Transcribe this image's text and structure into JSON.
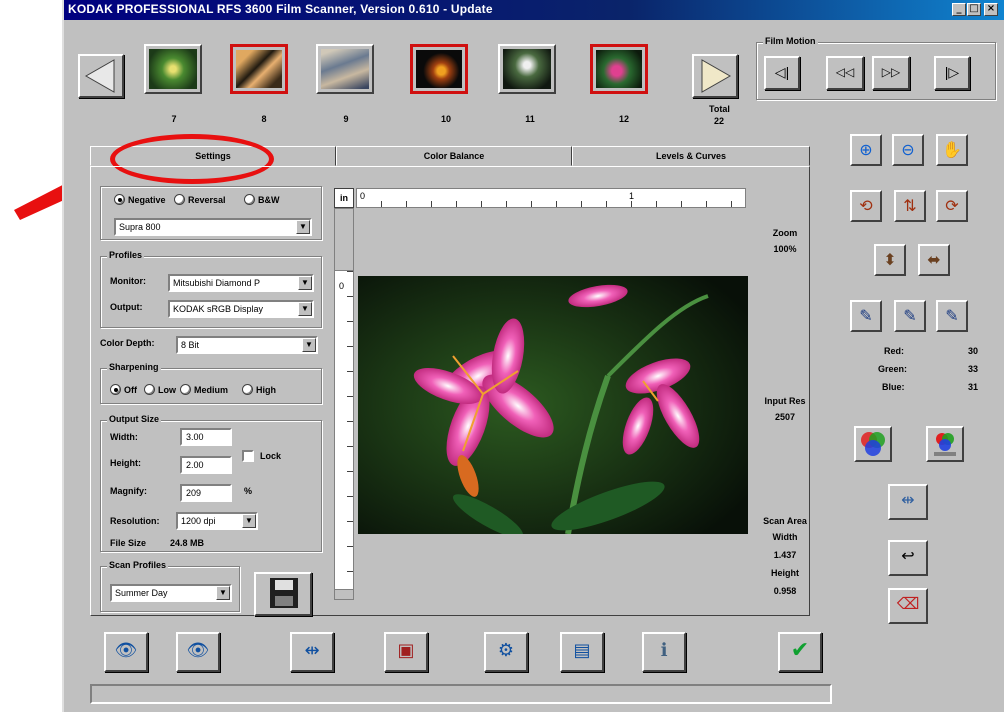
{
  "window": {
    "title": "KODAK PROFESSIONAL RFS 3600 Film Scanner, Version 0.610 - Update"
  },
  "filmstrip": {
    "thumbnails": [
      {
        "number": "7",
        "selected": false
      },
      {
        "number": "8",
        "selected": true
      },
      {
        "number": "9",
        "selected": false
      },
      {
        "number": "10",
        "selected": true
      },
      {
        "number": "11",
        "selected": false
      },
      {
        "number": "12",
        "selected": true
      }
    ],
    "total_label": "Total",
    "total_value": "22"
  },
  "film_motion": {
    "label": "Film Motion"
  },
  "tabs": [
    "Settings",
    "Color Balance",
    "Levels & Curves"
  ],
  "film_type": {
    "options": [
      "Negative",
      "Reversal",
      "B&W"
    ],
    "selected": "Negative",
    "film": "Supra 800"
  },
  "profiles": {
    "title": "Profiles",
    "monitor_label": "Monitor:",
    "monitor_value": "Mitsubishi Diamond P",
    "output_label": "Output:",
    "output_value": "KODAK sRGB Display"
  },
  "color_depth": {
    "label": "Color Depth:",
    "value": "8 Bit"
  },
  "sharpening": {
    "title": "Sharpening",
    "options": [
      "Off",
      "Low",
      "Medium",
      "High"
    ],
    "selected": "Off"
  },
  "output_size": {
    "title": "Output Size",
    "width_label": "Width:",
    "width_value": "3.00",
    "height_label": "Height:",
    "height_value": "2.00",
    "lock_label": "Lock",
    "magnify_label": "Magnify:",
    "magnify_value": "209",
    "magnify_unit": "%",
    "resolution_label": "Resolution:",
    "resolution_value": "1200 dpi",
    "file_size_label": "File Size",
    "file_size_value": "24.8 MB"
  },
  "scan_profiles": {
    "title": "Scan Profiles",
    "value": "Summer Day"
  },
  "ruler": {
    "unit": "in",
    "h_marks": [
      "0",
      "1"
    ],
    "v_marks": [
      "0"
    ]
  },
  "info": {
    "zoom_label": "Zoom",
    "zoom_value": "100%",
    "input_res_label": "Input Res",
    "input_res_value": "2507",
    "scan_area_label": "Scan Area",
    "width_label": "Width",
    "width_value": "1.437",
    "height_label": "Height",
    "height_value": "0.958"
  },
  "rgb": {
    "red_label": "Red:",
    "red_value": "30",
    "green_label": "Green:",
    "green_value": "33",
    "blue_label": "Blue:",
    "blue_value": "31"
  }
}
